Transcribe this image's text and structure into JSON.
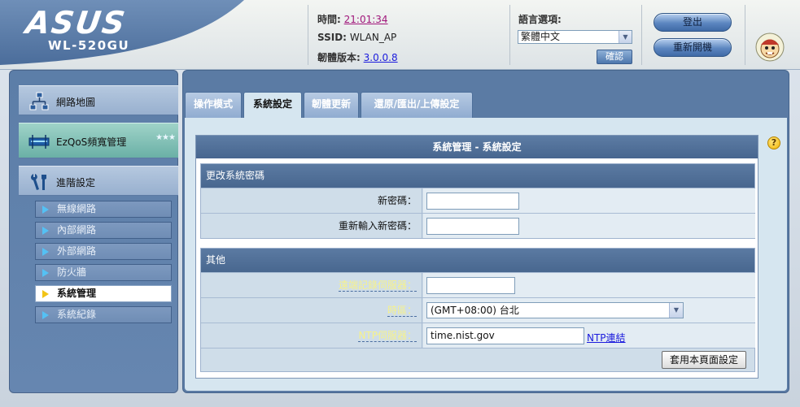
{
  "header": {
    "brand": "ASUS",
    "model": "WL-520GU",
    "time_label": "時間:",
    "time_value": "21:01:34",
    "ssid_label": "SSID:",
    "ssid_value": "WLAN_AP",
    "firmware_label": "韌體版本:",
    "firmware_value": "3.0.0.8",
    "language_label": "語言選項:",
    "language_value": "繁體中文",
    "language_apply": "確認",
    "logout_label": "登出",
    "reboot_label": "重新開機"
  },
  "sidebar": {
    "main_items": [
      {
        "label": "網路地圖",
        "icon": "network-map-icon"
      },
      {
        "label": "EzQoS頻寬管理",
        "icon": "ezqos-icon"
      },
      {
        "label": "進階設定",
        "icon": "tools-icon"
      }
    ],
    "sub_items": [
      {
        "label": "無線網路",
        "active": false
      },
      {
        "label": "內部網路",
        "active": false
      },
      {
        "label": "外部網路",
        "active": false
      },
      {
        "label": "防火牆",
        "active": false
      },
      {
        "label": "系統管理",
        "active": true
      },
      {
        "label": "系統紀錄",
        "active": false
      }
    ]
  },
  "tabs": [
    {
      "label": "操作模式",
      "active": false
    },
    {
      "label": "系統設定",
      "active": true
    },
    {
      "label": "韌體更新",
      "active": false
    },
    {
      "label": "還原/匯出/上傳設定",
      "active": false
    }
  ],
  "form": {
    "title": "系統管理 - 系統設定",
    "password_section": {
      "heading": "更改系統密碼",
      "new_password_label": "新密碼：",
      "new_password_value": "",
      "retype_password_label": "重新輸入新密碼：",
      "retype_password_value": ""
    },
    "misc_section": {
      "heading": "其他",
      "remote_log_label": "遠端記錄伺服器：",
      "remote_log_value": "",
      "timezone_label": "時區：",
      "timezone_value": "(GMT+08:00) 台北",
      "ntp_label": "NTP伺服器：",
      "ntp_value": "time.nist.gov",
      "ntp_link": "NTP連結"
    },
    "apply_label": "套用本頁面設定"
  }
}
